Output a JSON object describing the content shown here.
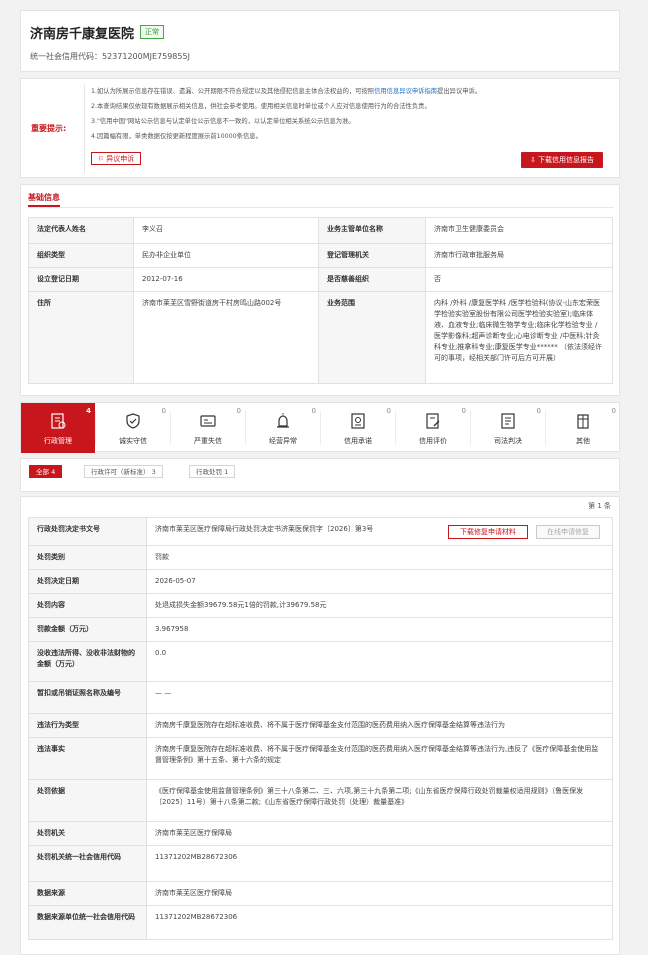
{
  "org": {
    "name": "济南房千康复医院",
    "status": "正常",
    "credit_code_label": "统一社会信用代码：",
    "credit_code": "52371200MJE759855J"
  },
  "notice": {
    "label": "重要提示:",
    "line1_pre": "1.如认为所展示信息存在错误、遗漏、公开期限不符合规定以及其他侵犯信息主体合法权益的，可按照",
    "line1_link": "信用信息异议申诉指南",
    "line1_post": "提出异议申诉。",
    "line2": "2.本查询结果仅依现有数据展示相关信息，供社会参考使用。使用相关信息时单位或个人应对信息使用行为的合法性负责。",
    "line3": "3.\"信用中国\"网站公示信息与认定单位公示信息不一致的，以认定单位相关系统公示信息为准。",
    "line4": "4.因篇幅有限，单类数据仅按更新程度展示前10000条信息。",
    "objection_label": "异议申诉",
    "download_label": "下载信用信息报告"
  },
  "basic": {
    "title": "基础信息",
    "rows": [
      {
        "k1": "法定代表人姓名",
        "v1": "李义召",
        "k2": "业务主管单位名称",
        "v2": "济南市卫生健康委员会"
      },
      {
        "k1": "组织类型",
        "v1": "民办非企业单位",
        "k2": "登记管理机关",
        "v2": "济南市行政审批服务局"
      },
      {
        "k1": "设立登记日期",
        "v1": "2012-07-16",
        "k2": "是否慈善组织",
        "v2": "否"
      },
      {
        "k1": "住所",
        "v1": "济南市莱芜区雪野街道房干村房鸣山路002号",
        "k2": "业务范围",
        "v2": "内科 /外科 /康复医学科 /医学检验科(协议-山东宏荣医学检验实验室股份有限公司医学检验实验室);临床体液、血液专业;临床微生物学专业;临床化学检验专业 /医学影像科;超声诊断专业;心电诊断专业 /中医科;针灸科专业;推拿科专业;康复医学专业****** （依法须经许可的事项，经相关部门许可后方可开展）"
      }
    ]
  },
  "tabs": [
    {
      "label": "行政管理",
      "count": "4",
      "icon": "admin-doc-icon"
    },
    {
      "label": "诚实守信",
      "count": "0",
      "icon": "honesty-shield-icon"
    },
    {
      "label": "严重失信",
      "count": "0",
      "icon": "dishonest-id-icon"
    },
    {
      "label": "经营异常",
      "count": "0",
      "icon": "alarm-light-icon"
    },
    {
      "label": "信用承诺",
      "count": "0",
      "icon": "commitment-cert-icon"
    },
    {
      "label": "信用评价",
      "count": "0",
      "icon": "rating-edit-icon"
    },
    {
      "label": "司法判决",
      "count": "0",
      "icon": "judgment-doc-icon"
    },
    {
      "label": "其他",
      "count": "0",
      "icon": "other-building-icon"
    }
  ],
  "filters": [
    {
      "label": "全部",
      "count": "4"
    },
    {
      "label": "行政许可（新标准）",
      "count": "3"
    },
    {
      "label": "行政处罚",
      "count": "1"
    }
  ],
  "record": {
    "count_text": "第 1 条",
    "repair_label": "下载修复申请材料",
    "online_label": "在线申请修复",
    "rows": [
      {
        "k": "行政处罚决定书文号",
        "v": "济南市莱芜区医疗保障局行政处罚决定书济莱医保罚字〔2026〕第3号"
      },
      {
        "k": "处罚类别",
        "v": "罚款"
      },
      {
        "k": "处罚决定日期",
        "v": "2026-05-07"
      },
      {
        "k": "处罚内容",
        "v": "处退成损失金额39679.58元1倍的罚款,计39679.58元"
      },
      {
        "k": "罚款金额（万元）",
        "v": "3.967958"
      },
      {
        "k": "没收违法所得、没收非法财物的金额（万元）",
        "v": "0.0"
      },
      {
        "k": "暂扣或吊销证照名称及编号",
        "v": "— —"
      },
      {
        "k": "违法行为类型",
        "v": "济南房千康复医院存在超标准收费、将不属于医疗保障基金支付范围的医药费用纳入医疗保障基金结算等违法行为"
      },
      {
        "k": "违法事实",
        "v": "济南房千康复医院存在超标准收费、将不属于医疗保障基金支付范围的医药费用纳入医疗保障基金结算等违法行为,违反了《医疗保障基金使用监督管理条例》第十五条、第十六条的规定"
      },
      {
        "k": "处罚依据",
        "v": "《医疗保障基金使用监督管理条例》第三十八条第二、三、六项,第三十九条第二项;《山东省医疗保障行政处罚裁量权适用规则》（鲁医保发〔2025〕11号）第十八条第二款;《山东省医疗保障行政处罚（处理）裁量基准》"
      },
      {
        "k": "处罚机关",
        "v": "济南市莱芜区医疗保障局"
      },
      {
        "k": "处罚机关统一社会信用代码",
        "v": "11371202MB2867230​6"
      },
      {
        "k": "数据来源",
        "v": "济南市莱芜区医疗保障局"
      },
      {
        "k": "数据来源单位统一社会信用代码",
        "v": "11371202MB28672306"
      }
    ]
  }
}
